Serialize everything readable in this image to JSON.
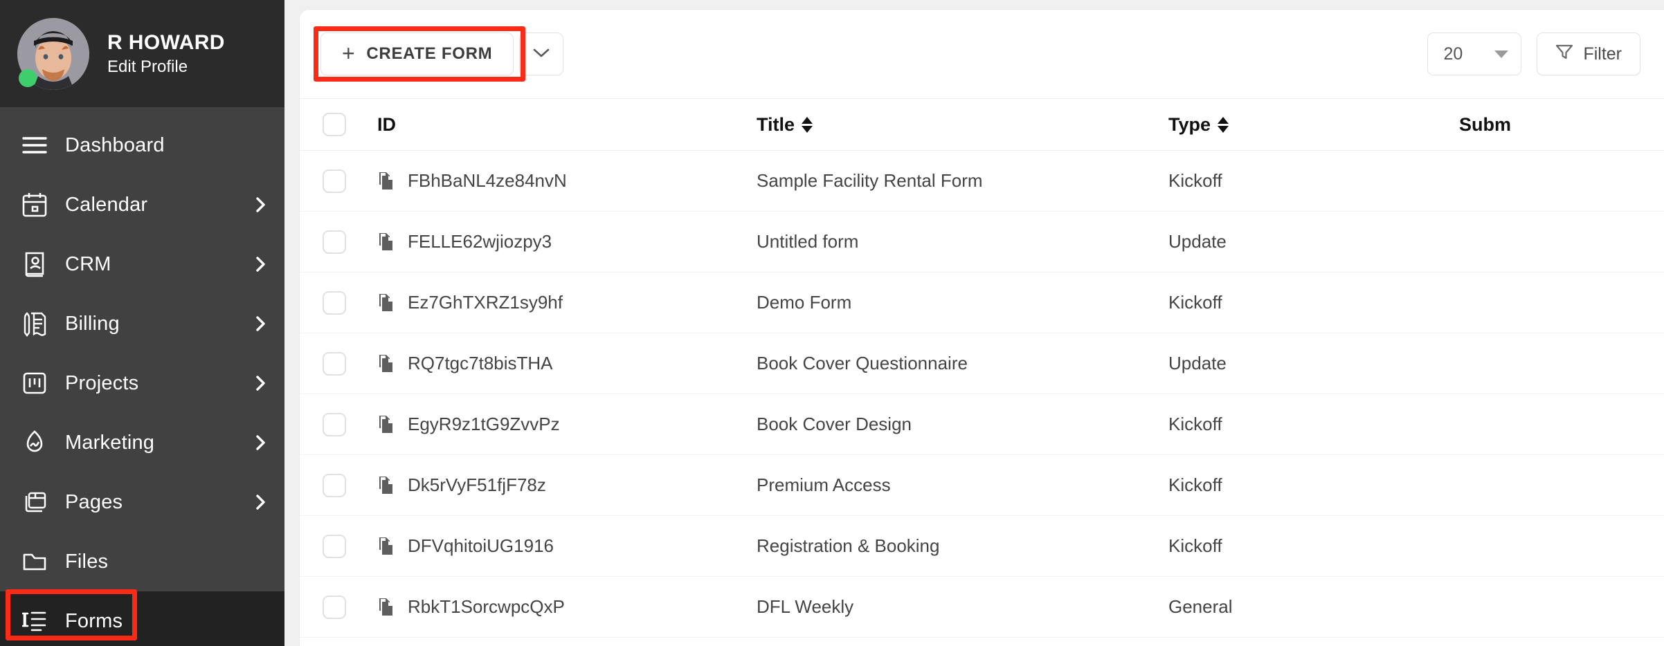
{
  "sidebar": {
    "profile": {
      "name": "R HOWARD",
      "edit_link": "Edit Profile",
      "status": "online",
      "status_color": "#3ece6b"
    },
    "items": [
      {
        "label": "Dashboard",
        "icon": "hamburger-icon",
        "expandable": false,
        "active": false
      },
      {
        "label": "Calendar",
        "icon": "calendar-icon",
        "expandable": true,
        "active": false
      },
      {
        "label": "CRM",
        "icon": "address-book-icon",
        "expandable": true,
        "active": false
      },
      {
        "label": "Billing",
        "icon": "invoice-pen-icon",
        "expandable": true,
        "active": false
      },
      {
        "label": "Projects",
        "icon": "kanban-board-icon",
        "expandable": true,
        "active": false
      },
      {
        "label": "Marketing",
        "icon": "flame-icon",
        "expandable": true,
        "active": false
      },
      {
        "label": "Pages",
        "icon": "windows-icon",
        "expandable": true,
        "active": false
      },
      {
        "label": "Files",
        "icon": "folder-icon",
        "expandable": false,
        "active": false
      },
      {
        "label": "Forms",
        "icon": "form-list-icon",
        "expandable": false,
        "active": true
      }
    ]
  },
  "toolbar": {
    "create_label": "CREATE FORM",
    "create_plus": "+",
    "dropdown_icon": "chevron-down-icon",
    "page_size_value": "20",
    "filter_label": "Filter",
    "filter_icon": "funnel-icon"
  },
  "annotations": {
    "color": "#fc2b17",
    "targets": [
      "create-form-button",
      "sidebar-item-forms"
    ]
  },
  "table": {
    "columns": [
      {
        "key": "check",
        "label": "",
        "sortable": false
      },
      {
        "key": "id",
        "label": "ID",
        "sortable": false
      },
      {
        "key": "title",
        "label": "Title",
        "sortable": true
      },
      {
        "key": "type",
        "label": "Type",
        "sortable": true
      },
      {
        "key": "submissions",
        "label": "Subm",
        "sortable": false
      }
    ],
    "rows": [
      {
        "id": "FBhBaNL4ze84nvN",
        "title": "Sample Facility Rental Form",
        "type": "Kickoff"
      },
      {
        "id": "FELLE62wjiozpy3",
        "title": "Untitled form",
        "type": "Update"
      },
      {
        "id": "Ez7GhTXRZ1sy9hf",
        "title": "Demo Form",
        "type": "Kickoff"
      },
      {
        "id": "RQ7tgc7t8bisTHA",
        "title": "Book Cover Questionnaire",
        "type": "Update"
      },
      {
        "id": "EgyR9z1tG9ZvvPz",
        "title": "Book Cover Design",
        "type": "Kickoff"
      },
      {
        "id": "Dk5rVyF51fjF78z",
        "title": "Premium Access",
        "type": "Kickoff"
      },
      {
        "id": "DFVqhitoiUG1916",
        "title": "Registration & Booking",
        "type": "Kickoff"
      },
      {
        "id": "RbkT1SorcwpcQxP",
        "title": "DFL Weekly",
        "type": "General"
      }
    ]
  }
}
